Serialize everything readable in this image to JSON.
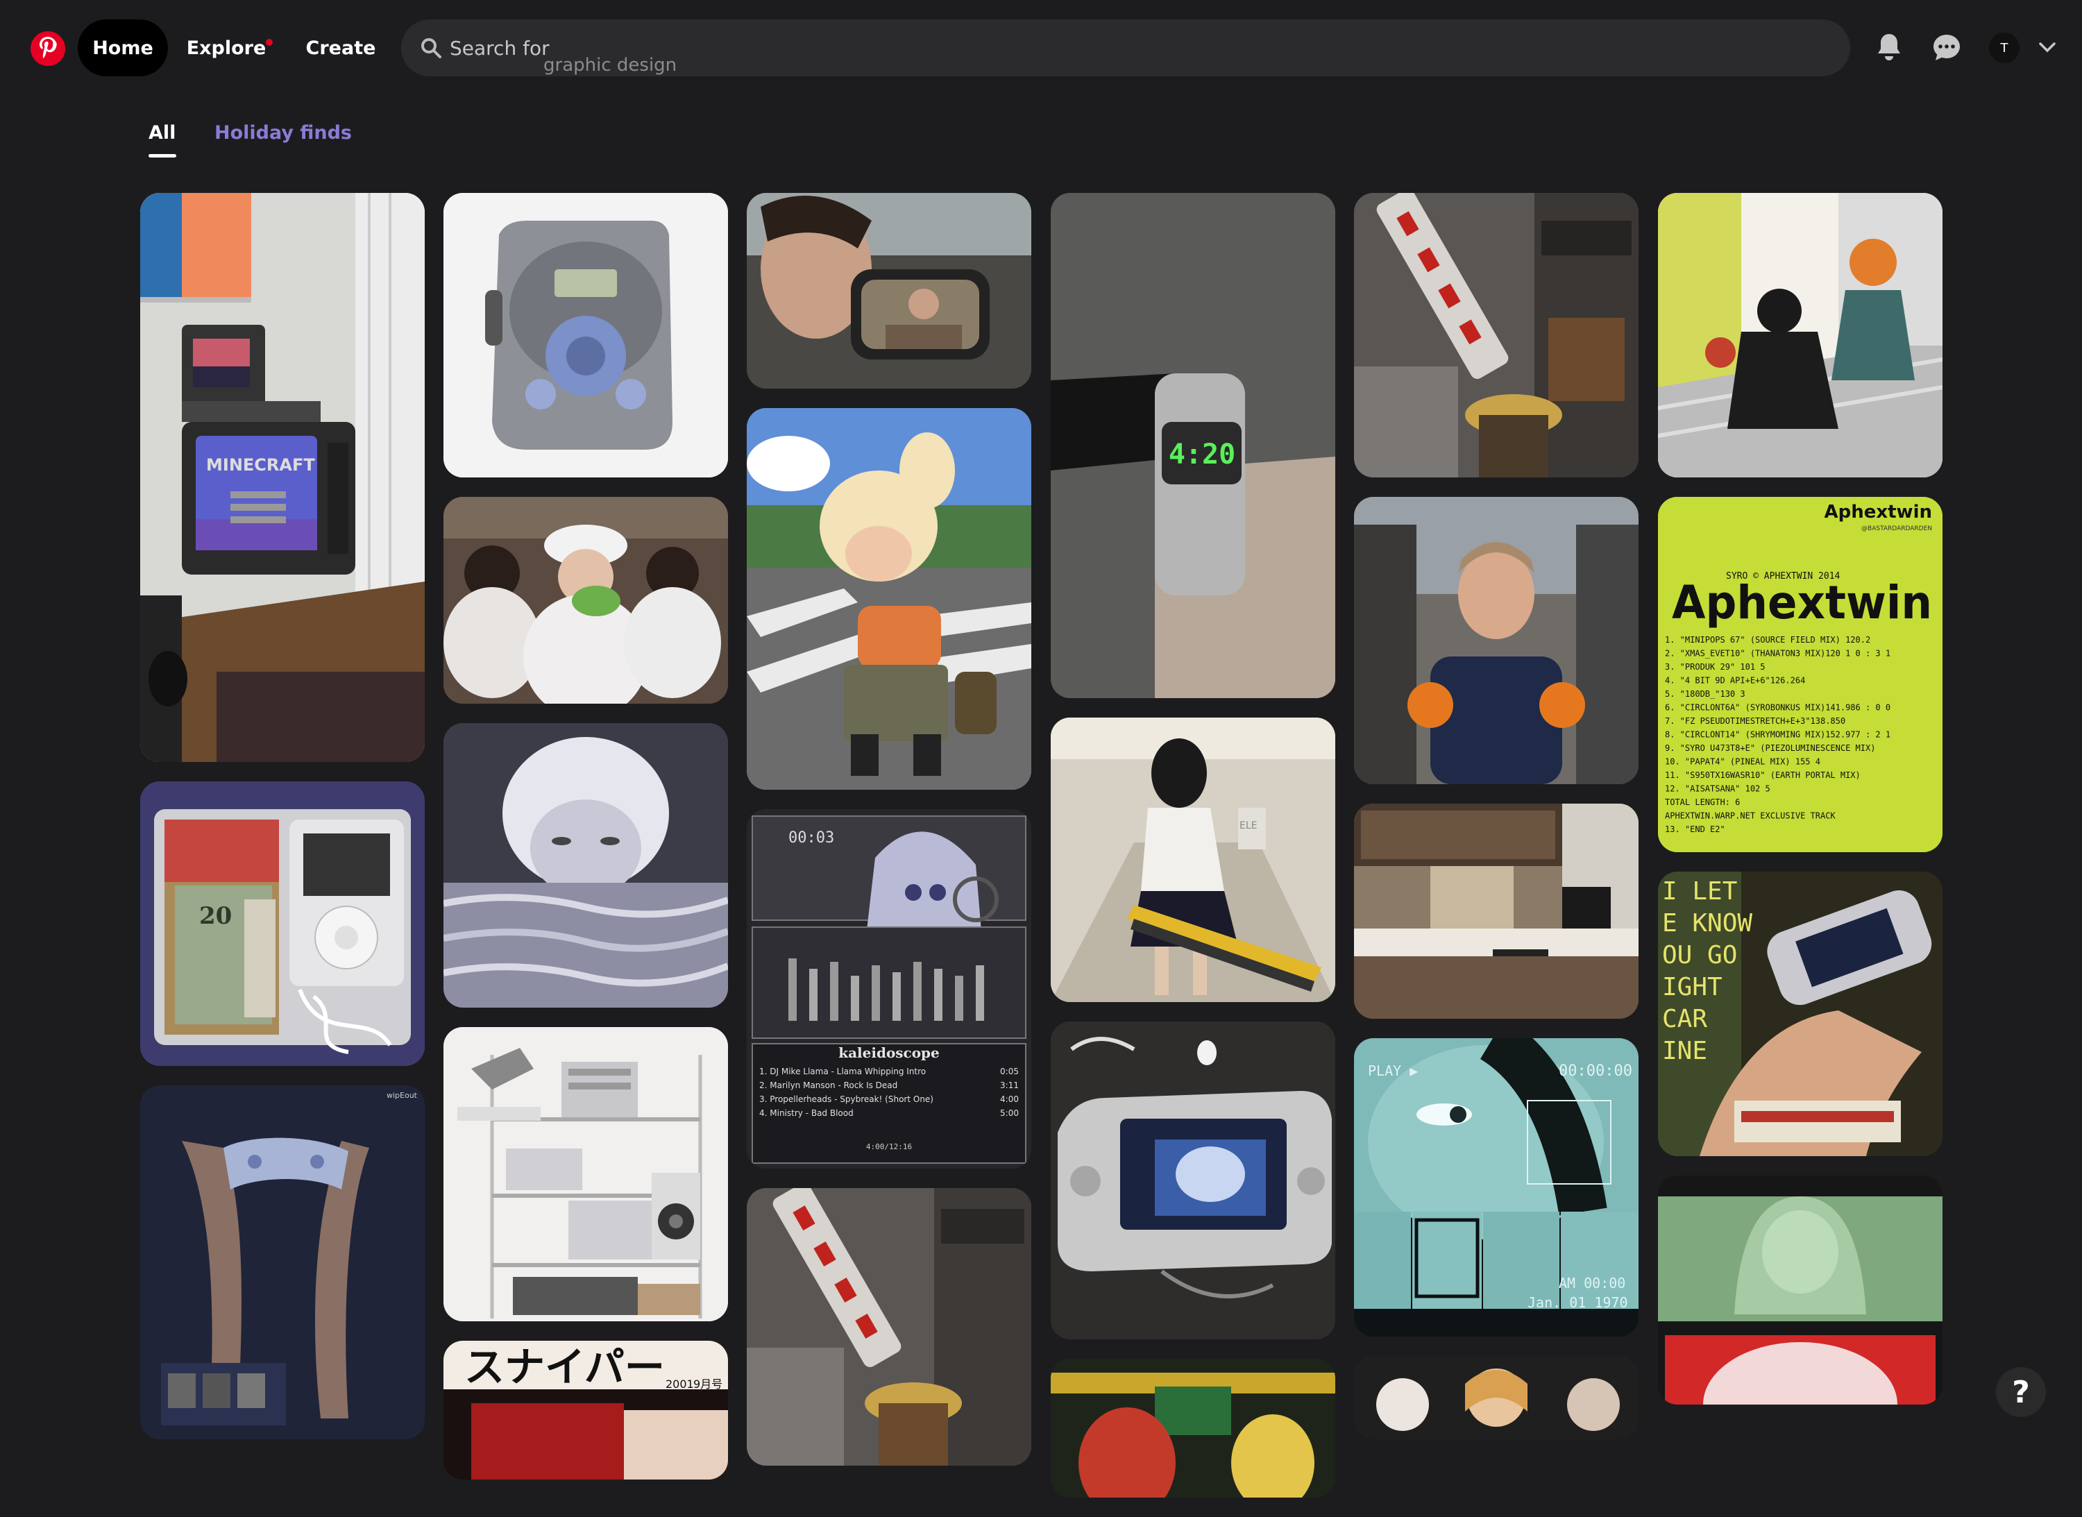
{
  "header": {
    "logo_icon": "pinterest-logo",
    "nav": {
      "home": "Home",
      "explore": "Explore",
      "create": "Create"
    },
    "search": {
      "placeholder": "Search for",
      "ticker": "graphic design"
    },
    "avatar_initial": "T"
  },
  "tabs": {
    "all": "All",
    "holiday": "Holiday finds"
  },
  "pins": {
    "minecraft": {
      "title": "MINECRAFT"
    },
    "aphex": {
      "brand": "Aphextwin",
      "byline": "@BASTARDARDARDEN",
      "subtitle": "SYRO © APHEXTWIN 2014",
      "wordmark": "Aphextwin",
      "tracks": [
        "1. \"MINIPOPS 67\" (SOURCE FIELD MIX) 120.2",
        "2. \"XMAS_EVET10\" (THANATON3 MIX)120 1 0 : 3 1",
        "3. \"PRODUK 29\" 101 5",
        "4. \"4 BIT 9D API+E+6\"126.264",
        "5. \"180DB_\"130 3",
        "6. \"CIRCLONT6A\" (SYROBONKUS MIX)141.986 : 0 0",
        "7. \"FZ PSEUDOTIMESTRETCH+E+3\"138.850",
        "8. \"CIRCLONT14\" (SHRYMOMING MIX)152.977 : 2 1",
        "9. \"SYRO U473T8+E\" (PIEZOLUMINESCENCE MIX)",
        "10. \"PAPAT4\" (PINEAL MIX) 155 4",
        "11. \"S950TX16WASR10\" (EARTH PORTAL MIX)",
        "12. \"AISATSANA\" 102 5",
        "TOTAL LENGTH: 6",
        "APHEXTWIN.WARP.NET  EXCLUSIVE  TRACK",
        "13.  \"END E2\""
      ]
    },
    "winamp": {
      "title": "kaleidoscope",
      "time": "00:03",
      "counter": "4:00/12:16",
      "playlist": [
        {
          "name": "1. DJ Mike Llama - Llama Whipping Intro",
          "len": "0:05"
        },
        {
          "name": "2. Marilyn Manson - Rock Is Dead",
          "len": "3:11"
        },
        {
          "name": "3. Propellerheads - Spybreak! (Short One)",
          "len": "4:00"
        },
        {
          "name": "4. Ministry - Bad Blood",
          "len": "5:00"
        }
      ]
    },
    "watch": {
      "time": "4:20"
    },
    "vhs": {
      "play": "PLAY ▶",
      "time": "00:00:00",
      "am": "AM 00:00",
      "date": "Jan. 01 1970"
    },
    "psx": {
      "brand": "wipEout"
    },
    "chainsaw": {
      "sign": "ELE"
    },
    "sniper": {
      "title": "スナイパー",
      "year": "2001",
      "month": "9月号"
    },
    "letknow": {
      "text": "I LET\nE KNOW\nOU GO\nIGHT\nCAR\nINE"
    },
    "dollar": {
      "value": "20"
    }
  },
  "colors": {
    "brand": "#e60023",
    "holiday_tab": "#8a7bd6",
    "background": "#1c1c1e"
  }
}
